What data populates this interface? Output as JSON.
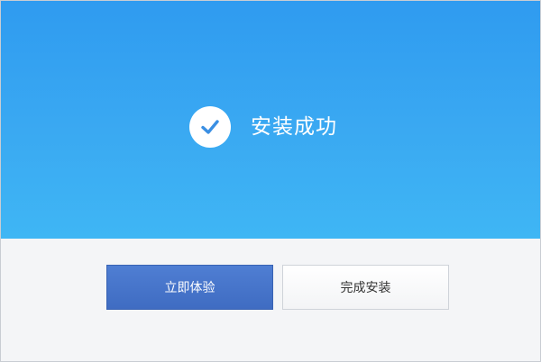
{
  "status": {
    "icon": "check-icon",
    "message": "安装成功"
  },
  "actions": {
    "primary_label": "立即体验",
    "secondary_label": "完成安装"
  },
  "colors": {
    "hero_top": "#2f9bf0",
    "hero_bottom": "#3fb6f4",
    "primary_button": "#4474c8",
    "check": "#3a8fe3"
  }
}
